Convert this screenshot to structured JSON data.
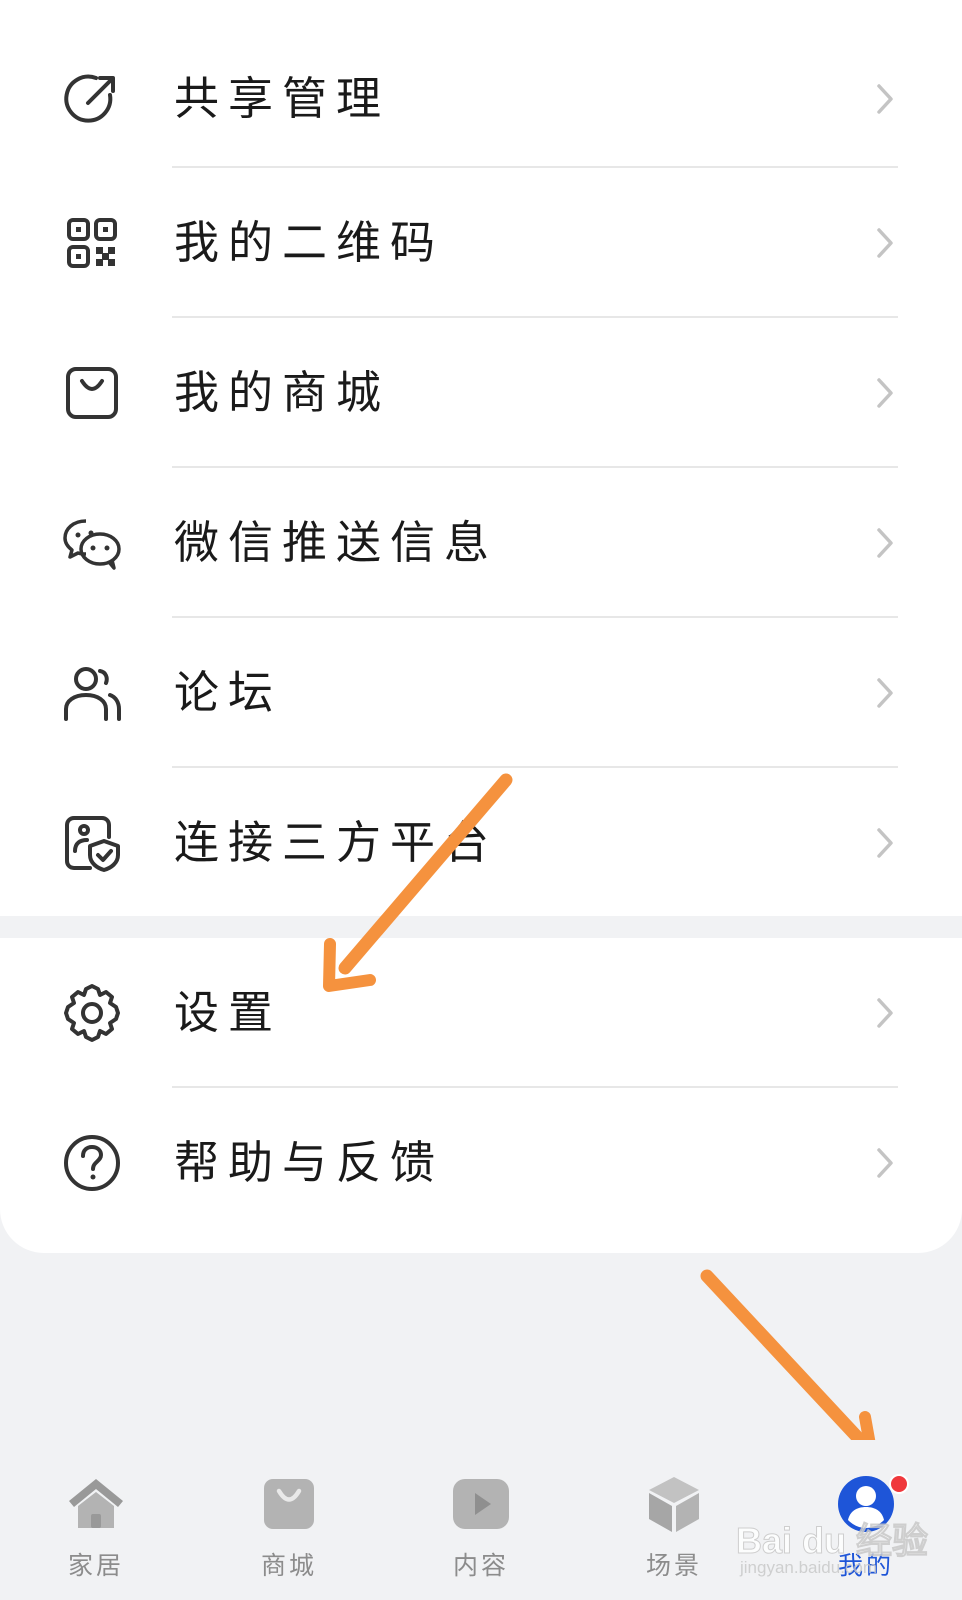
{
  "menu_section1": [
    {
      "label": "共享管理",
      "icon": "share-export-icon"
    },
    {
      "label": "我的二维码",
      "icon": "qr-code-icon"
    },
    {
      "label": "我的商城",
      "icon": "shopping-bag-icon"
    },
    {
      "label": "微信推送信息",
      "icon": "wechat-icon"
    },
    {
      "label": "论坛",
      "icon": "forum-users-icon"
    },
    {
      "label": "连接三方平台",
      "icon": "third-party-shield-icon"
    }
  ],
  "menu_section2": [
    {
      "label": "设置",
      "icon": "gear-icon"
    },
    {
      "label": "帮助与反馈",
      "icon": "help-question-icon"
    }
  ],
  "bottom_nav": [
    {
      "label": "家居",
      "icon": "home-icon",
      "active": false
    },
    {
      "label": "商城",
      "icon": "mall-bag-icon",
      "active": false
    },
    {
      "label": "内容",
      "icon": "play-content-icon",
      "active": false
    },
    {
      "label": "场景",
      "icon": "scene-cube-icon",
      "active": false
    },
    {
      "label": "我的",
      "icon": "profile-icon",
      "active": true
    }
  ],
  "watermark": {
    "logo": "Bai du 经验",
    "url": "jingyan.baidu.com"
  },
  "colors": {
    "accent": "#1e55d8",
    "badge": "#f0383c",
    "annotation_arrow": "#f5923e",
    "icon": "#333333",
    "chevron": "#c4c4c4"
  }
}
